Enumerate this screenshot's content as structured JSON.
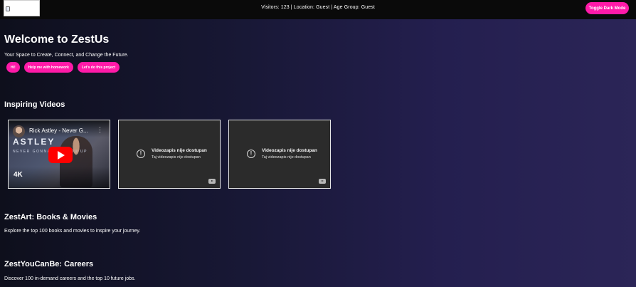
{
  "topbar": {
    "visitor_info": "Visitors: 123 | Location: Guest | Age Group: Guest",
    "dark_mode_label": "Toggle Dark Mode"
  },
  "hero": {
    "title": "Welcome to ZestUs",
    "tagline": "Your Space to Create, Connect, and Change the Future.",
    "chips": [
      "Hi!",
      "Help me with homework",
      "Let's do this project"
    ]
  },
  "videos": {
    "heading": "Inspiring Videos",
    "items": [
      {
        "title": "Rick Astley - Never G...",
        "overlay_line1": "ASTLEY",
        "overlay_line2": "NEVER GONNA GIVE YOU UP",
        "quality": "4K",
        "menu": "⋮"
      },
      {
        "error_title": "Videozapis nije dostupan",
        "error_detail": "Taj videozapis nije dostupan"
      },
      {
        "error_title": "Videozapis nije dostupan",
        "error_detail": "Taj videozapis nije dostupan"
      }
    ]
  },
  "zestart": {
    "heading": "ZestArt: Books & Movies",
    "description": "Explore the top 100 books and movies to inspire your journey."
  },
  "careers": {
    "heading": "ZestYouCanBe: Careers",
    "description": "Discover 100 in-demand careers and the top 10 future jobs."
  },
  "colors": {
    "accent": "#ff1aa8",
    "topbar": "#0a0a0a",
    "bg_left": "#0e0f1c",
    "bg_right": "#2b2557"
  }
}
